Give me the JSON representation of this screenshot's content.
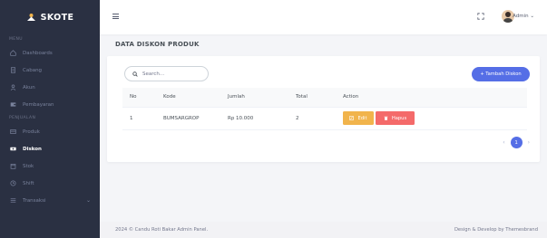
{
  "brand": {
    "name": "SKOTE"
  },
  "sidebar": {
    "menu_title": "MENU",
    "items": [
      {
        "label": "Dashboards",
        "icon": "home-icon"
      },
      {
        "label": "Cabang",
        "icon": "document-icon"
      },
      {
        "label": "Akun",
        "icon": "user-icon"
      },
      {
        "label": "Pembayaran",
        "icon": "wallet-icon"
      }
    ],
    "section2_title": "PENJUALAN",
    "items2": [
      {
        "label": "Produk",
        "icon": "box-icon"
      },
      {
        "label": "Diskon",
        "icon": "discount-icon",
        "active": true
      },
      {
        "label": "Stok",
        "icon": "store-icon"
      },
      {
        "label": "Shift",
        "icon": "clock-icon"
      },
      {
        "label": "Transaksi",
        "icon": "list-icon",
        "chevron": "⌄"
      }
    ]
  },
  "topbar": {
    "user_name": "Admin ⌄"
  },
  "page": {
    "title": "DATA DISKON PRODUK"
  },
  "search": {
    "placeholder": "Search..."
  },
  "actions": {
    "add_label": "+ Tambah Diskon"
  },
  "table": {
    "headers": [
      "No",
      "Kode",
      "Jumlah",
      "Total",
      "Action"
    ],
    "rows": [
      {
        "no": "1",
        "kode": "BUMSARGROP",
        "jumlah": "Rp 10.000",
        "total": "2",
        "edit_label": "Edit",
        "delete_label": "Hapus"
      }
    ]
  },
  "pagination": {
    "prev": "‹",
    "current": "1",
    "next": "›"
  },
  "footer": {
    "left": "2024 © Candu Roti Bakar Admin Panel.",
    "right": "Design & Develop by Themesbrand"
  },
  "colors": {
    "sidebar_bg": "#2a3042",
    "primary": "#556ee6",
    "warning": "#f1b44c",
    "danger": "#f46a6a"
  }
}
